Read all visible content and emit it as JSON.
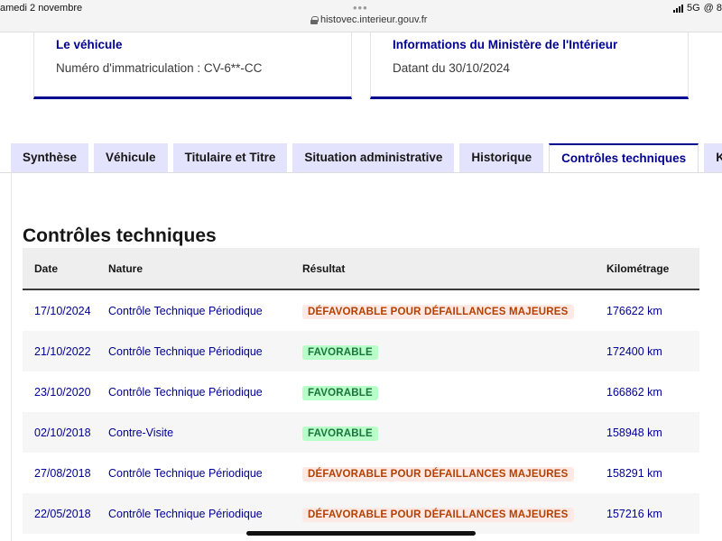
{
  "status_bar": {
    "date": "amedi 2 novembre",
    "dots": "•••",
    "url": "histovec.interieur.gouv.fr",
    "network": "5G",
    "extra": "@ 8"
  },
  "cards": {
    "vehicle": {
      "title": "Le véhicule",
      "text": "Numéro d'immatriculation : CV-6**-CC"
    },
    "ministry": {
      "title": "Informations du Ministère de l'Intérieur",
      "text": "Datant du 30/10/2024"
    }
  },
  "tabs": [
    {
      "label": "Synthèse",
      "active": false
    },
    {
      "label": "Véhicule",
      "active": false
    },
    {
      "label": "Titulaire et Titre",
      "active": false
    },
    {
      "label": "Situation administrative",
      "active": false
    },
    {
      "label": "Historique",
      "active": false
    },
    {
      "label": "Contrôles techniques",
      "active": true
    },
    {
      "label": "Kilo",
      "active": false
    }
  ],
  "section": {
    "title": "Contrôles techniques"
  },
  "table": {
    "headers": {
      "date": "Date",
      "nature": "Nature",
      "result": "Résultat",
      "km": "Kilométrage"
    },
    "rows": [
      {
        "date": "17/10/2024",
        "nature": "Contrôle Technique Périodique",
        "result": "DÉFAVORABLE POUR DÉFAILLANCES MAJEURES",
        "status": "bad",
        "km": "176622 km"
      },
      {
        "date": "21/10/2022",
        "nature": "Contrôle Technique Périodique",
        "result": "FAVORABLE",
        "status": "good",
        "km": "172400 km"
      },
      {
        "date": "23/10/2020",
        "nature": "Contrôle Technique Périodique",
        "result": "FAVORABLE",
        "status": "good",
        "km": "166862 km"
      },
      {
        "date": "02/10/2018",
        "nature": "Contre-Visite",
        "result": "FAVORABLE",
        "status": "good",
        "km": "158948 km"
      },
      {
        "date": "27/08/2018",
        "nature": "Contrôle Technique Périodique",
        "result": "DÉFAVORABLE POUR DÉFAILLANCES MAJEURES",
        "status": "bad",
        "km": "158291 km"
      },
      {
        "date": "22/05/2018",
        "nature": "Contrôle Technique Périodique",
        "result": "DÉFAVORABLE POUR DÉFAILLANCES MAJEURES",
        "status": "bad",
        "km": "157216 km"
      }
    ]
  },
  "colors": {
    "brand_blue": "#000091",
    "tab_bg": "#e3e3fd",
    "bad_bg": "#fee9e5",
    "bad_text": "#b34000",
    "good_bg": "#b8fec9",
    "good_text": "#18753c"
  }
}
